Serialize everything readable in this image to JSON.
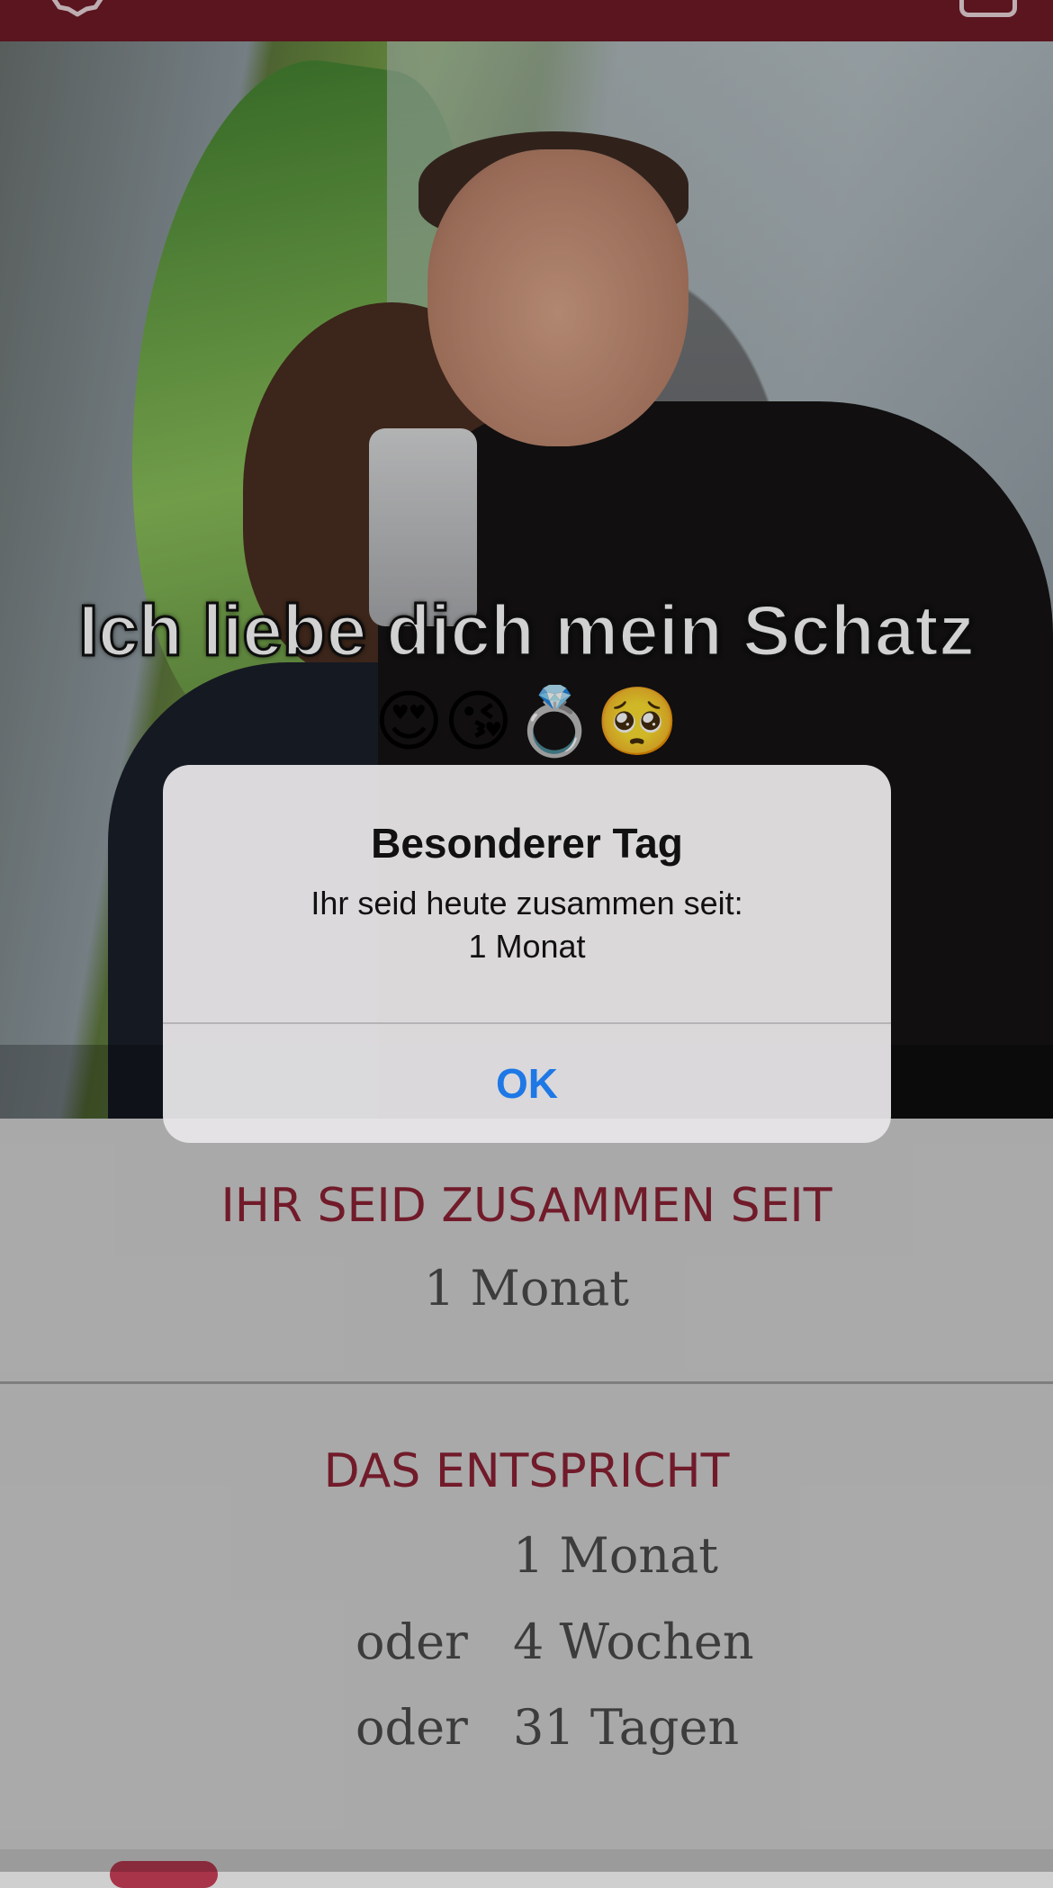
{
  "photo": {
    "caption": "Ich liebe dich mein Schatz",
    "caption_emoji": "😍😘💍🥺"
  },
  "top_bar": {
    "emoji": "🥰😊😊❤️"
  },
  "together": {
    "title": "IHR SEID ZUSAMMEN SEIT",
    "value": "1 Monat"
  },
  "equivalent": {
    "title": "DAS ENTSPRICHT",
    "rows": [
      {
        "prefix": "",
        "value": "1 Monat"
      },
      {
        "prefix": "oder",
        "value": "4 Wochen"
      },
      {
        "prefix": "oder",
        "value": "31 Tagen"
      }
    ]
  },
  "alert": {
    "title": "Besonderer Tag",
    "message_line1": "Ihr seid heute zusammen seit:",
    "message_line2": "1 Monat",
    "ok_label": "OK"
  },
  "colors": {
    "top_bar": "#6e1a27",
    "accent": "#8a2234",
    "ios_blue": "#1e78e6"
  }
}
